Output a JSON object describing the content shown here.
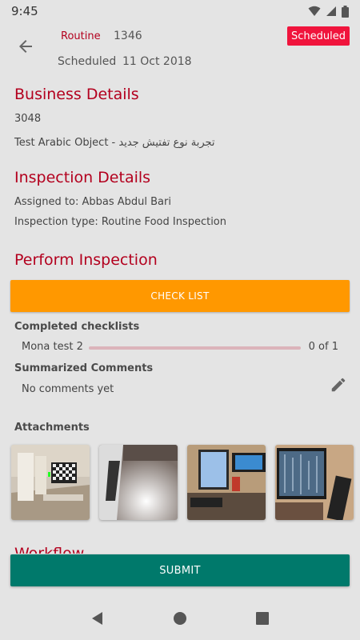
{
  "status_bar": {
    "time": "9:45"
  },
  "header": {
    "inspection_type": "Routine",
    "inspection_number": "1346",
    "status_label": "Scheduled",
    "date": "11 Oct 2018",
    "badge": "Scheduled"
  },
  "business": {
    "title": "Business Details",
    "id": "3048",
    "name": "Test Arabic Object - تجربة نوع تفتيش جديد"
  },
  "inspection": {
    "title": "Inspection Details",
    "assigned": "Assigned to: Abbas Abdul Bari",
    "type": "Inspection type:  Routine Food Inspection"
  },
  "perform": {
    "title": "Perform Inspection",
    "checklist_button": "CHECK LIST",
    "completed_label": "Completed checklists",
    "checklists": [
      {
        "name": "Mona test 2",
        "count": "0 of 1",
        "progress": 0
      }
    ],
    "comments_label": "Summarized Comments",
    "comments_text": "No comments yet"
  },
  "attachments": {
    "label": "Attachments",
    "items": [
      "room-photo",
      "surface-photo",
      "desk-photo",
      "monitor-photo"
    ]
  },
  "workflow": {
    "title": "Workflow"
  },
  "submit_button": "SUBMIT",
  "colors": {
    "accent": "#b3001e",
    "badge": "#f0143c",
    "checklist_button": "#ff9800",
    "submit_button": "#00796b"
  }
}
